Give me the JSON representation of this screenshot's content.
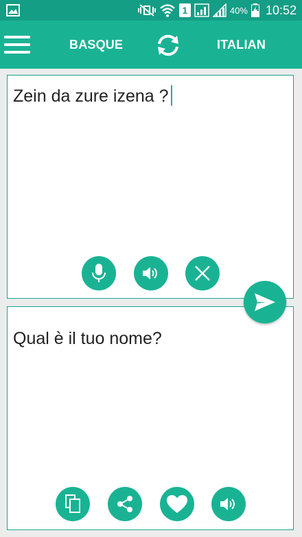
{
  "status_bar": {
    "battery_percent": "40%",
    "sim_slot": "1",
    "time": "10:52"
  },
  "toolbar": {
    "source_language": "BASQUE",
    "target_language": "ITALIAN"
  },
  "input_panel": {
    "text": "Zein da zure izena ?",
    "buttons": [
      "mic-icon",
      "speaker-icon",
      "close-icon"
    ]
  },
  "output_panel": {
    "text": "Qual è il tuo nome?",
    "buttons": [
      "copy-icon",
      "share-icon",
      "heart-icon",
      "speaker-icon"
    ]
  },
  "colors": {
    "status_bar": "#149e85",
    "toolbar": "#19b394",
    "accent": "#19b394",
    "background": "#ececec"
  }
}
